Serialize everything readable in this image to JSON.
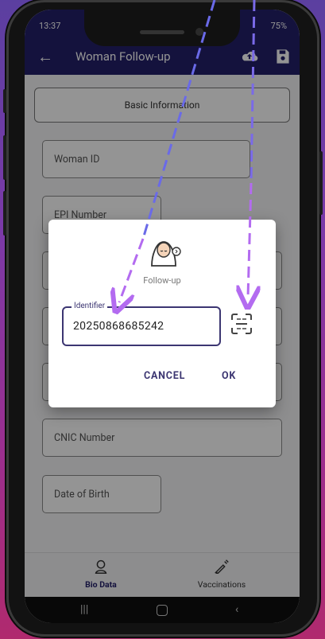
{
  "status": {
    "time": "13:37",
    "right": "75%"
  },
  "appbar": {
    "title": "Woman Follow-up"
  },
  "sections": {
    "basic_info": "Basic Information"
  },
  "form": {
    "woman_id": "Woman ID",
    "epi_number": "EPI Number",
    "cnic_number": "CNIC Number",
    "date_of_birth": "Date of Birth"
  },
  "dialog": {
    "caption": "Follow-up",
    "identifier_label": "Identifier",
    "identifier_value": "20250868685242",
    "cancel": "CANCEL",
    "ok": "OK"
  },
  "bottom_nav": {
    "bio_data": "Bio Data",
    "vaccinations": "Vaccinations"
  },
  "colors": {
    "primary": "#24206a",
    "accent_arrow": "#b36bf0",
    "accent_arrow_blue": "#6a6ae8"
  }
}
